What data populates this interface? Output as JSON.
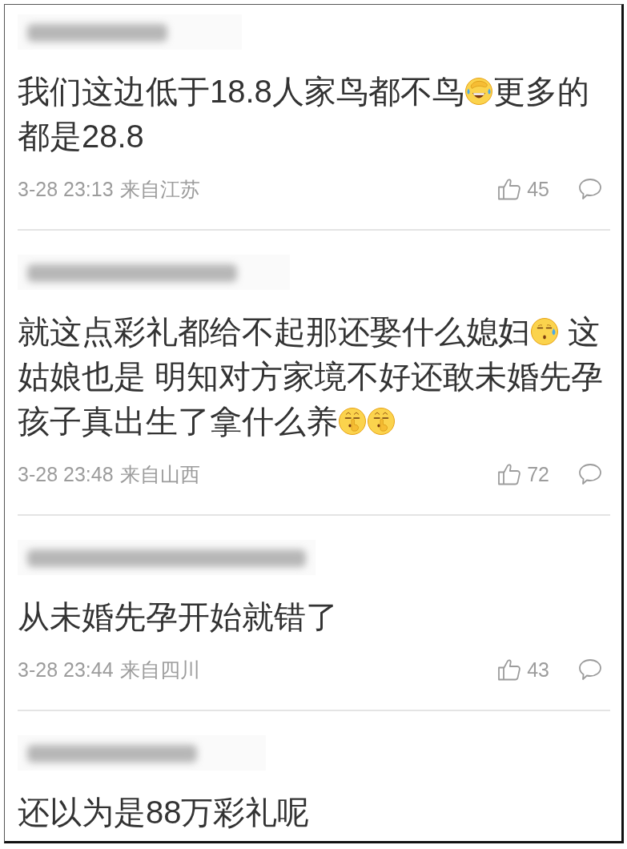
{
  "comments": [
    {
      "content_lines": [
        [
          {
            "kind": "text",
            "text": "我们这边低于18.8人家鸟都不鸟"
          },
          {
            "kind": "laughcry"
          },
          {
            "kind": "text",
            "text": "更多的"
          }
        ],
        [
          {
            "kind": "text",
            "text": "都是28.8"
          }
        ]
      ],
      "time": "3-28 23:13",
      "location": "来自江苏",
      "likes": "45"
    },
    {
      "content_lines": [
        [
          {
            "kind": "text",
            "text": "就这点彩礼都给不起那还娶什么媳妇"
          },
          {
            "kind": "sweat"
          },
          {
            "kind": "text",
            "text": " 这"
          }
        ],
        [
          {
            "kind": "text",
            "text": "姑娘也是 明知对方家境不好还敢未婚先孕"
          }
        ],
        [
          {
            "kind": "text",
            "text": "孩子真出生了拿什么养"
          },
          {
            "kind": "shush"
          },
          {
            "kind": "shush"
          }
        ]
      ],
      "time": "3-28 23:48",
      "location": "来自山西",
      "likes": "72"
    },
    {
      "content_lines": [
        [
          {
            "kind": "text",
            "text": "从未婚先孕开始就错了"
          }
        ]
      ],
      "time": "3-28 23:44",
      "location": "来自四川",
      "likes": "43"
    },
    {
      "content_lines": [
        [
          {
            "kind": "text",
            "text": "还以为是88万彩礼呢"
          }
        ]
      ]
    }
  ]
}
